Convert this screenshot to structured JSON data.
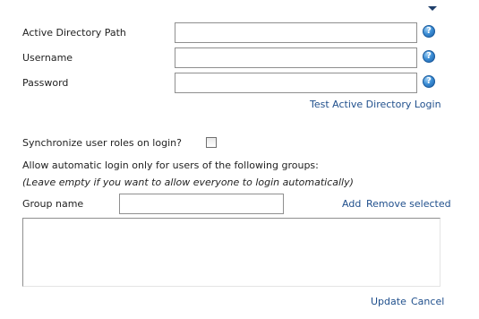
{
  "icons": {
    "collapse": "caret-down-icon",
    "help": "help-icon",
    "help_glyph": "?"
  },
  "colors": {
    "link": "#1f4f8c",
    "help_icon": "#3d8fd6"
  },
  "ad": {
    "path_label": "Active Directory Path",
    "path_value": "",
    "username_label": "Username",
    "username_value": "",
    "password_label": "Password",
    "password_value": "",
    "test_link": "Test Active Directory Login"
  },
  "sync": {
    "label": "Synchronize user roles on login?",
    "checked": false
  },
  "groups": {
    "intro": "Allow automatic login only for users of the following groups:",
    "hint": "(Leave empty if you want to allow everyone to login automatically)",
    "name_label": "Group name",
    "name_value": "",
    "add_link": "Add",
    "remove_link": "Remove selected",
    "items": []
  },
  "footer": {
    "update_link": "Update",
    "cancel_link": "Cancel"
  }
}
